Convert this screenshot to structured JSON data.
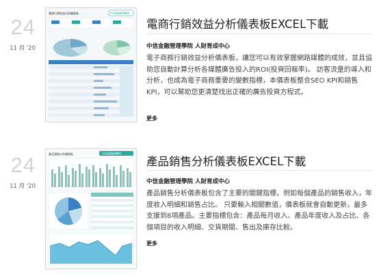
{
  "posts": [
    {
      "day": "24",
      "month": "11 月 '20",
      "title": "電商行銷效益分析儀表板EXCEL下載",
      "author": "中信金融管理學院 人財育成中心",
      "excerpt": "電子商務行銷效益分析儀表板，讓您可以有效掌握網路媒體的成效，並且協助您自動計算分析各媒體廣告投入的ROI(投資回報率)。 訪客流量的導入和分析，也成為電子商務重要的變數指標，本儀表板整合SEO KPI和銷售KPI，可以幫助您更清楚找出正確的廣告投資方程式。",
      "more": "更多",
      "thumb_label": "電商行銷效益分析儀表板",
      "thumb_badge": "中信金融管理學院"
    },
    {
      "day": "24",
      "month": "11 月 '20",
      "title": "產品銷售分析儀表板EXCEL下載",
      "author": "中信金融管理學院 人財育成中心",
      "excerpt": "產品銷售分析儀表板包含了主要的關鍵指標，例如每個產品的銷售收入，年度收入明細和銷售占比。 只要輸入相關數值，儀表板就會自動更新，最多支援到8項產品。主要指標包含：產品每月收入、產品年度收入及占比、各個項目的收入明細、交貨期間、售出及庫存比較。",
      "more": "更多",
      "thumb_label": "產品銷售分析儀表板",
      "thumb_badge": "中信金融管理學院"
    }
  ],
  "colors": {
    "accent_teal": "#2fa8a0",
    "accent_blue": "#3b7fc4",
    "date_grey": "#d4d4d4"
  }
}
